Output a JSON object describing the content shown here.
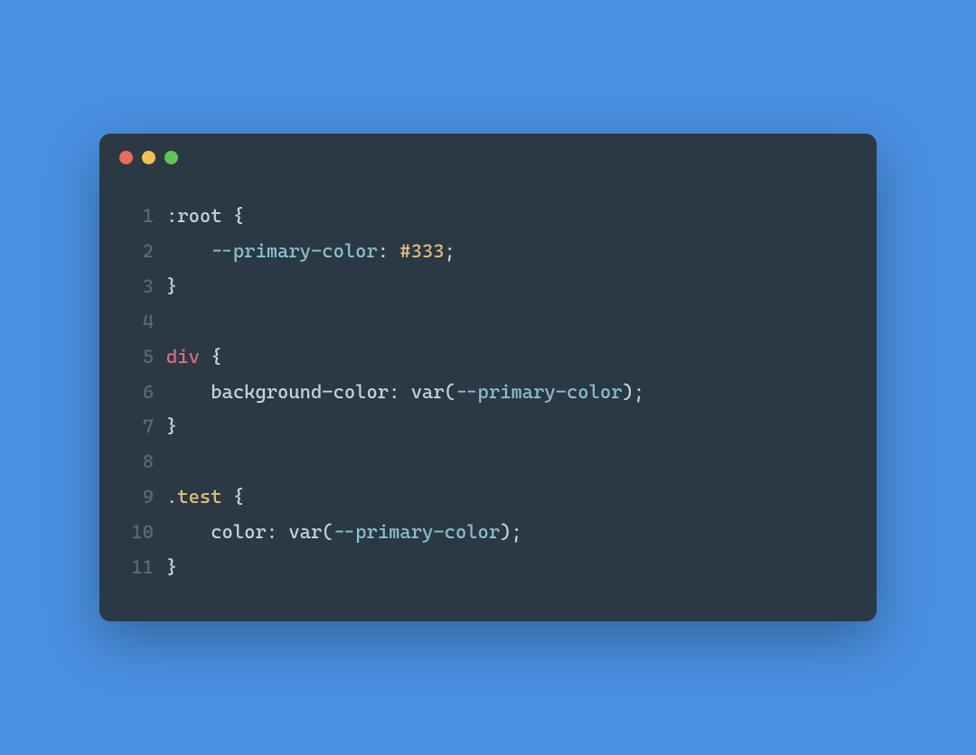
{
  "window": {
    "traffic_lights": {
      "red": "#ec6a5e",
      "yellow": "#f4bf4f",
      "green": "#61c554"
    }
  },
  "code": {
    "language": "css",
    "line_count": 11,
    "lines": [
      {
        "num": "1",
        "tokens": [
          {
            "t": ":root ",
            "c": "sel-pseudo"
          },
          {
            "t": "{",
            "c": "punct"
          }
        ]
      },
      {
        "num": "2",
        "tokens": [
          {
            "t": "    ",
            "c": "punct"
          },
          {
            "t": "--primary-color",
            "c": "varname"
          },
          {
            "t": ": ",
            "c": "punct"
          },
          {
            "t": "#333",
            "c": "val-hex"
          },
          {
            "t": ";",
            "c": "punct"
          }
        ]
      },
      {
        "num": "3",
        "tokens": [
          {
            "t": "}",
            "c": "punct"
          }
        ]
      },
      {
        "num": "4",
        "tokens": [
          {
            "t": "",
            "c": "punct"
          }
        ]
      },
      {
        "num": "5",
        "tokens": [
          {
            "t": "div ",
            "c": "sel-tag"
          },
          {
            "t": "{",
            "c": "punct"
          }
        ]
      },
      {
        "num": "6",
        "tokens": [
          {
            "t": "    ",
            "c": "punct"
          },
          {
            "t": "background-color",
            "c": "prop"
          },
          {
            "t": ": ",
            "c": "punct"
          },
          {
            "t": "var",
            "c": "func"
          },
          {
            "t": "(",
            "c": "punct"
          },
          {
            "t": "--primary-color",
            "c": "varname"
          },
          {
            "t": ")",
            "c": "punct"
          },
          {
            "t": ";",
            "c": "punct"
          }
        ]
      },
      {
        "num": "7",
        "tokens": [
          {
            "t": "}",
            "c": "punct"
          }
        ]
      },
      {
        "num": "8",
        "tokens": [
          {
            "t": "",
            "c": "punct"
          }
        ]
      },
      {
        "num": "9",
        "tokens": [
          {
            "t": ".test ",
            "c": "sel-class"
          },
          {
            "t": "{",
            "c": "punct"
          }
        ]
      },
      {
        "num": "10",
        "tokens": [
          {
            "t": "    ",
            "c": "punct"
          },
          {
            "t": "color",
            "c": "prop"
          },
          {
            "t": ": ",
            "c": "punct"
          },
          {
            "t": "var",
            "c": "func"
          },
          {
            "t": "(",
            "c": "punct"
          },
          {
            "t": "--primary-color",
            "c": "varname"
          },
          {
            "t": ")",
            "c": "punct"
          },
          {
            "t": ";",
            "c": "punct"
          }
        ]
      },
      {
        "num": "11",
        "tokens": [
          {
            "t": "}",
            "c": "punct"
          }
        ]
      }
    ]
  }
}
